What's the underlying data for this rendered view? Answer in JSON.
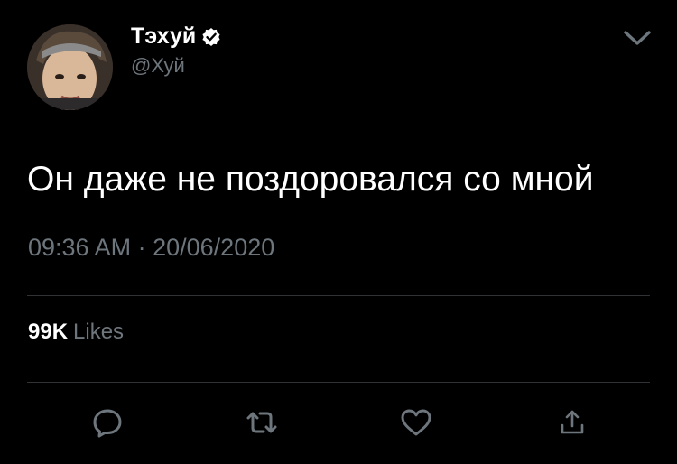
{
  "user": {
    "display_name": "Тэхуй",
    "handle": "@Хуй",
    "verified": true
  },
  "tweet": {
    "text": "Он даже не поздоровался со мной",
    "time": "09:36 AM",
    "separator": "·",
    "date": "20/06/2020"
  },
  "stats": {
    "likes_count": "99K",
    "likes_label": "Likes"
  },
  "icons": {
    "more": "chevron-down-icon",
    "reply": "reply-icon",
    "retweet": "retweet-icon",
    "like": "heart-icon",
    "share": "share-icon",
    "verified": "verified-badge-icon"
  },
  "colors": {
    "background": "#000000",
    "text": "#ffffff",
    "secondary": "#6e767d",
    "divider": "#2f3336"
  }
}
